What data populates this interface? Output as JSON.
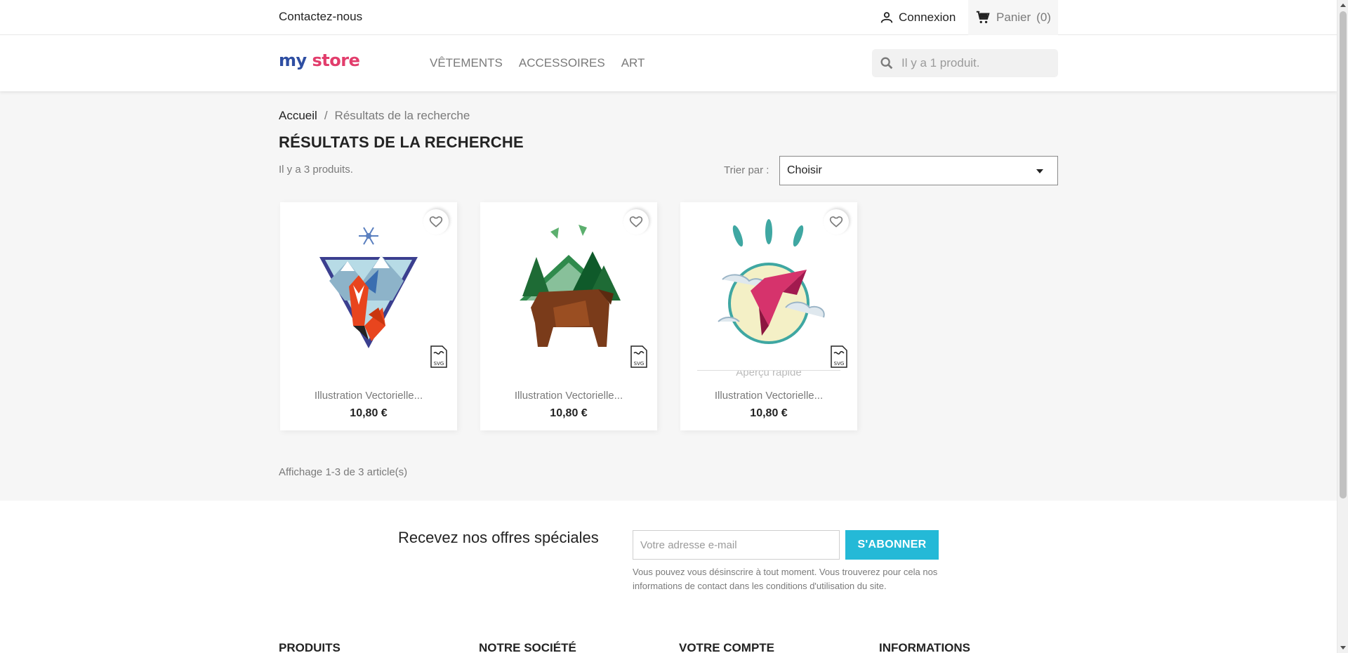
{
  "header": {
    "contact_label": "Contactez-nous",
    "login_label": "Connexion",
    "cart_label": "Panier",
    "cart_count": "(0)"
  },
  "logo": {
    "text_a": "my",
    "text_b": "store"
  },
  "menu": {
    "items": [
      {
        "label": "VÊTEMENTS"
      },
      {
        "label": "ACCESSOIRES"
      },
      {
        "label": "ART"
      }
    ]
  },
  "search": {
    "placeholder": "Il y a 1 produit."
  },
  "breadcrumb": {
    "home": "Accueil",
    "separator": "/",
    "current": "Résultats de la recherche"
  },
  "page": {
    "title": "RÉSULTATS DE LA RECHERCHE",
    "count_text": "Il y a 3 produits.",
    "sort_label": "Trier par :",
    "sort_value": "Choisir",
    "pagination_text": "Affichage 1-3 de 3 article(s)"
  },
  "products": [
    {
      "name": "Illustration Vectorielle...",
      "price": "10,80 €",
      "badge": "SVG",
      "image": "fox-illustration"
    },
    {
      "name": "Illustration Vectorielle...",
      "price": "10,80 €",
      "badge": "SVG",
      "image": "bear-illustration"
    },
    {
      "name": "Illustration Vectorielle...",
      "price": "10,80 €",
      "badge": "SVG",
      "image": "hummingbird-illustration",
      "quick_view": "Aperçu rapide"
    }
  ],
  "newsletter": {
    "title": "Recevez nos offres spéciales",
    "placeholder": "Votre adresse e-mail",
    "button": "S'ABONNER",
    "note": "Vous pouvez vous désinscrire à tout moment. Vous trouverez pour cela nos informations de contact dans les conditions d'utilisation du site."
  },
  "footer": {
    "columns": [
      {
        "title": "PRODUITS"
      },
      {
        "title": "NOTRE SOCIÉTÉ"
      },
      {
        "title": "VOTRE COMPTE"
      },
      {
        "title": "INFORMATIONS"
      }
    ]
  },
  "colors": {
    "accent": "#24b9d7",
    "background": "#f6f6f6"
  }
}
